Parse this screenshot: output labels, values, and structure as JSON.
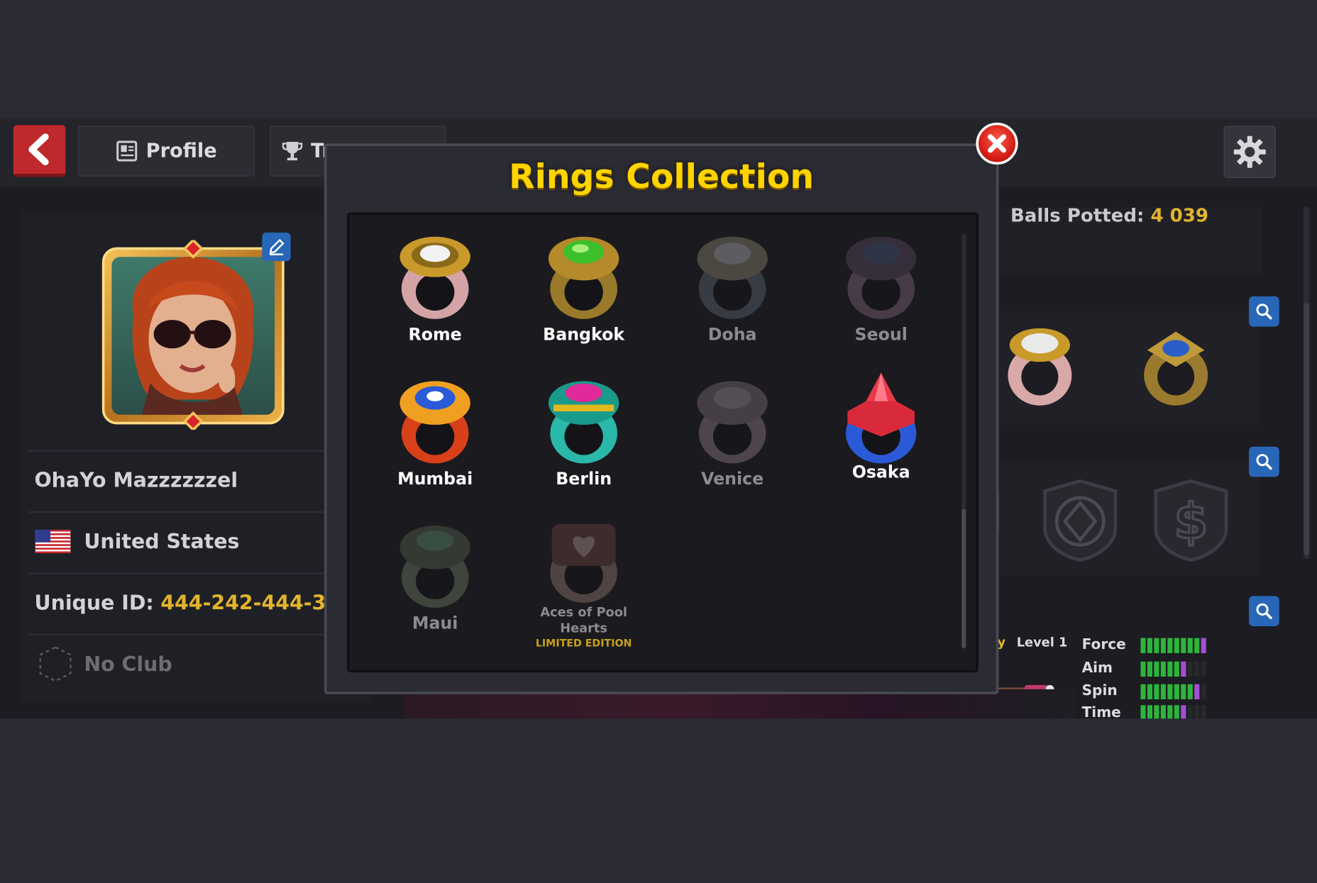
{
  "topbar": {
    "profile_tab": "Profile",
    "trophy_tab": "Tr",
    "back_icon": "chevron-left-icon",
    "settings_icon": "gear-icon"
  },
  "profile": {
    "name": "OhaYo Mazzzzzzel",
    "country": "United States",
    "unique_id_label": "Unique ID:",
    "unique_id": "444-242-444-3",
    "club": "No Club"
  },
  "stats": {
    "balls_potted_label": "Balls Potted:",
    "balls_potted": "4 039"
  },
  "cue": {
    "label_prefix": "ry",
    "level_label": "Level 1",
    "force_label": "Force",
    "aim_label": "Aim",
    "spin_label": "Spin",
    "time_label": "Time",
    "force": 9,
    "aim": 6,
    "spin": 8,
    "time": 6
  },
  "modal": {
    "title": "Rings Collection",
    "rings": [
      {
        "name": "Rome",
        "owned": true
      },
      {
        "name": "Bangkok",
        "owned": true
      },
      {
        "name": "Doha",
        "owned": false
      },
      {
        "name": "Seoul",
        "owned": false
      },
      {
        "name": "Mumbai",
        "owned": true
      },
      {
        "name": "Berlin",
        "owned": true
      },
      {
        "name": "Venice",
        "owned": false
      },
      {
        "name": "Osaka",
        "owned": true
      },
      {
        "name": "Maui",
        "owned": false
      },
      {
        "name": "Aces of Pool",
        "name_line2": "Hearts",
        "limited": "LIMITED EDITION",
        "owned": false
      }
    ]
  },
  "colors": {
    "accent_gold": "#e1b42b",
    "title_yellow": "#ffd400",
    "close_red": "#d11b12",
    "back_red": "#c0292b",
    "stat_green": "#2db43a",
    "stat_purple": "#a44fd6",
    "button_blue": "#2867b8"
  }
}
